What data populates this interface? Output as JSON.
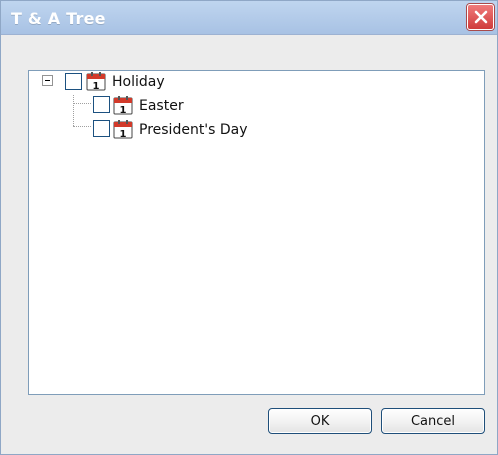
{
  "window": {
    "title": "T & A Tree"
  },
  "tree": {
    "root": {
      "label": "Holiday",
      "expanded": true,
      "checked": false,
      "icon": "calendar-icon",
      "children": [
        {
          "label": "Easter",
          "checked": false,
          "icon": "calendar-icon"
        },
        {
          "label": "President's Day",
          "checked": false,
          "icon": "calendar-icon"
        }
      ]
    }
  },
  "buttons": {
    "ok_label": "OK",
    "cancel_label": "Cancel"
  },
  "colors": {
    "titlebar": "#a8c2e4",
    "close_button": "#cf3b3b",
    "panel_border": "#7f9db9",
    "checkbox_border": "#1c5180"
  }
}
